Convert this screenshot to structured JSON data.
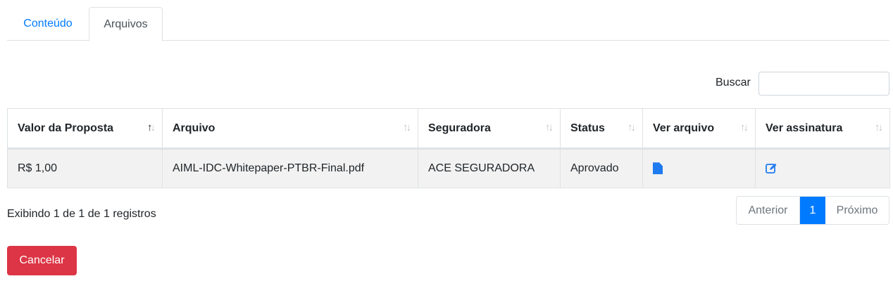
{
  "tabs": [
    {
      "label": "Conteúdo",
      "active": false
    },
    {
      "label": "Arquivos",
      "active": true
    }
  ],
  "search": {
    "label": "Buscar",
    "value": "",
    "placeholder": ""
  },
  "table": {
    "columns": [
      {
        "label": "Valor da Proposta",
        "sort": "asc"
      },
      {
        "label": "Arquivo",
        "sort": "none"
      },
      {
        "label": "Seguradora",
        "sort": "none"
      },
      {
        "label": "Status",
        "sort": "none"
      },
      {
        "label": "Ver arquivo",
        "sort": "none"
      },
      {
        "label": "Ver assinatura",
        "sort": "none"
      }
    ],
    "rows": [
      {
        "valor": "R$ 1,00",
        "arquivo": "AIML-IDC-Whitepaper-PTBR-Final.pdf",
        "seguradora": "ACE SEGURADORA",
        "status": "Aprovado",
        "ver_arquivo_icon": "file-icon",
        "ver_assinatura_icon": "edit-icon"
      }
    ]
  },
  "info": "Exibindo 1 de 1 de 1 registros",
  "pagination": {
    "prev": "Anterior",
    "current": "1",
    "next": "Próximo"
  },
  "cancel_label": "Cancelar",
  "colors": {
    "primary": "#007bff",
    "danger": "#dc3545",
    "row_bg": "#f2f2f2"
  }
}
